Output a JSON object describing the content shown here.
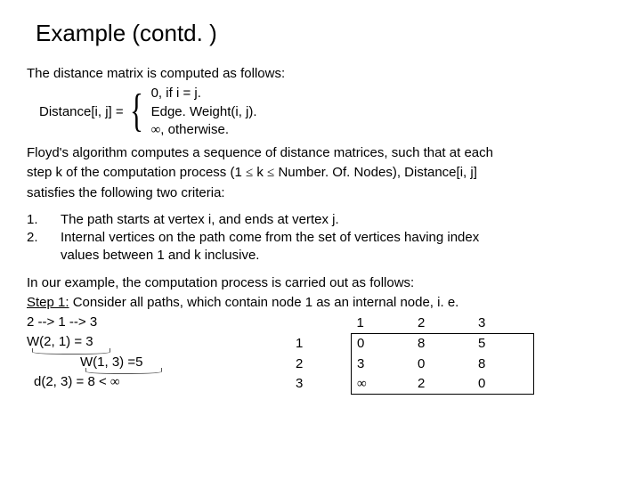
{
  "title": "Example (contd. )",
  "intro": "The distance matrix is computed as follows:",
  "def_label": "Distance[i, j] = ",
  "case1": "0, if i = j.",
  "case2": "Edge. Weight(i, j).",
  "case3_a": "∞",
  "case3_b": ", otherwise.",
  "floyd_a": "Floyd's algorithm computes a sequence of distance matrices, such that at each",
  "floyd_b_pre": "step k of the computation process (1 ",
  "floyd_b_le1": "≤",
  "floyd_b_mid": " k ",
  "floyd_b_le2": "≤",
  "floyd_b_post": " Number. Of. Nodes), Distance[i, j]",
  "floyd_c": "satisfies the following two criteria:",
  "crit_n1": "1.",
  "crit_n2": "2.",
  "crit_t1": "The path starts at vertex i, and ends at vertex j.",
  "crit_t2a": "Internal vertices on the path come from the set of vertices having index",
  "crit_t2b": "values between 1 and k inclusive.",
  "ex_intro": "In our example, the computation process is carried out as follows:",
  "step_label": "Step 1:",
  "step_rest": " Consider all paths, which contain node 1 as an internal node, i. e.",
  "path_line": "2  -->   1  -->   3",
  "w21": "W(2, 1) = 3",
  "w13": "W(1, 3) =5",
  "d23_pre": "d(2, 3) = 8 < ",
  "d23_inf": "∞",
  "matrix": {
    "h1": "1",
    "h2": "2",
    "h3": "3",
    "r1": "1",
    "r2": "2",
    "r3": "3",
    "c11": "0",
    "c12": "8",
    "c13": "5",
    "c21": "3",
    "c22": "0",
    "c23": "8",
    "c31": "∞",
    "c32": "2",
    "c33": "0"
  }
}
